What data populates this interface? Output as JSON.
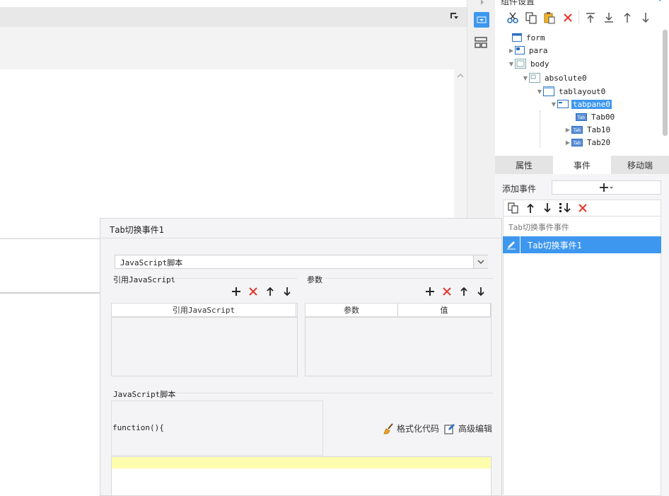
{
  "right_panel": {
    "title": "组件设置",
    "tree": [
      {
        "label": "form",
        "level": 0,
        "expander": "none"
      },
      {
        "label": "para",
        "level": 1,
        "expander": "collapsed"
      },
      {
        "label": "body",
        "level": 1,
        "expander": "expanded"
      },
      {
        "label": "absolute0",
        "level": 2,
        "expander": "expanded"
      },
      {
        "label": "tablayout0",
        "level": 3,
        "expander": "expanded"
      },
      {
        "label": "tabpane0",
        "level": 4,
        "expander": "expanded",
        "selected": true
      },
      {
        "label": "Tab00",
        "level": 5,
        "expander": "none"
      },
      {
        "label": "Tab10",
        "level": 5,
        "expander": "collapsed"
      },
      {
        "label": "Tab20",
        "level": 5,
        "expander": "collapsed"
      }
    ],
    "tabs": [
      "属性",
      "事件",
      "移动端"
    ],
    "active_tab": "事件",
    "add_event_label": "添加事件",
    "event_group_label": "Tab切换事件事件",
    "event_item_label": "Tab切换事件1"
  },
  "dialog": {
    "title": "Tab切换事件1",
    "type_select_value": "JavaScript脚本",
    "ref_js_label": "引用JavaScript",
    "ref_js_column": "引用JavaScript",
    "params_label": "参数",
    "params_columns": [
      "参数",
      "值"
    ],
    "js_script_label": "JavaScript脚本",
    "code_prefix": "function(){",
    "format_code_label": "格式化代码",
    "advanced_edit_label": "高级编辑"
  },
  "colors": {
    "accent": "#3d97ef",
    "delete_red": "#e8342e",
    "editor_highlight": "#fdfdae"
  }
}
